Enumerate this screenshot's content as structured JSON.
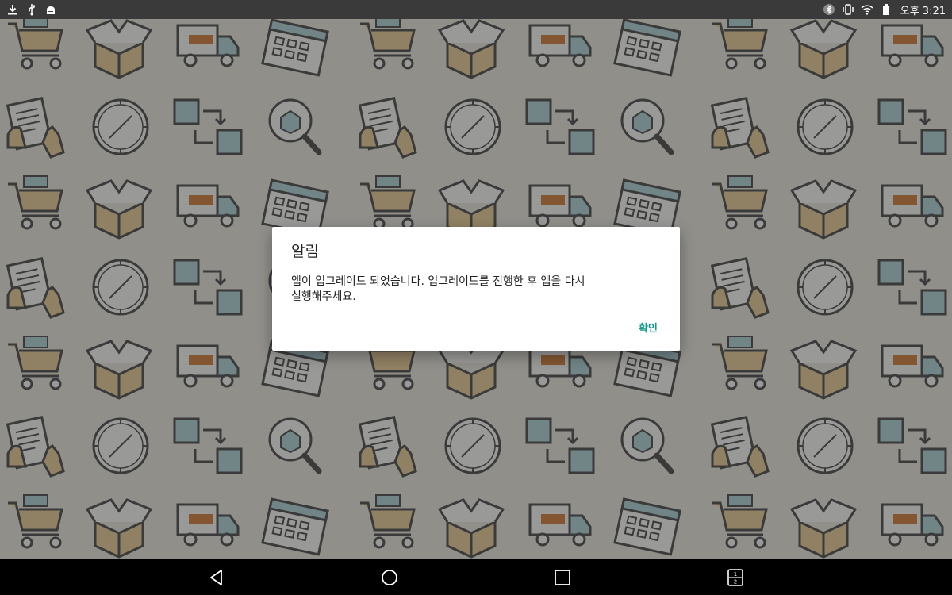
{
  "status_bar": {
    "left_icons": [
      "download-icon",
      "usb-icon",
      "android-debug-icon"
    ],
    "right_icons": [
      "bluetooth-icon",
      "vibrate-icon",
      "wifi-icon",
      "battery-icon"
    ],
    "time": "오후 3:21"
  },
  "background": {
    "icons": [
      "shopping-cart-icon",
      "open-box-icon",
      "delivery-truck-icon",
      "calendar-icon",
      "document-hand-icon",
      "compass-icon",
      "transfer-icon",
      "magnifier-box-icon"
    ]
  },
  "dialog": {
    "title": "알림",
    "message": "앱이 업그레이드 되었습니다. 업그레이드를 진행한 후 앱을 다시\n실행해주세요.",
    "confirm_label": "확인"
  },
  "nav_bar": {
    "buttons": [
      "back-icon",
      "home-icon",
      "recents-icon",
      "split-screen-icon"
    ],
    "split_top": "1",
    "split_bottom": "2"
  }
}
